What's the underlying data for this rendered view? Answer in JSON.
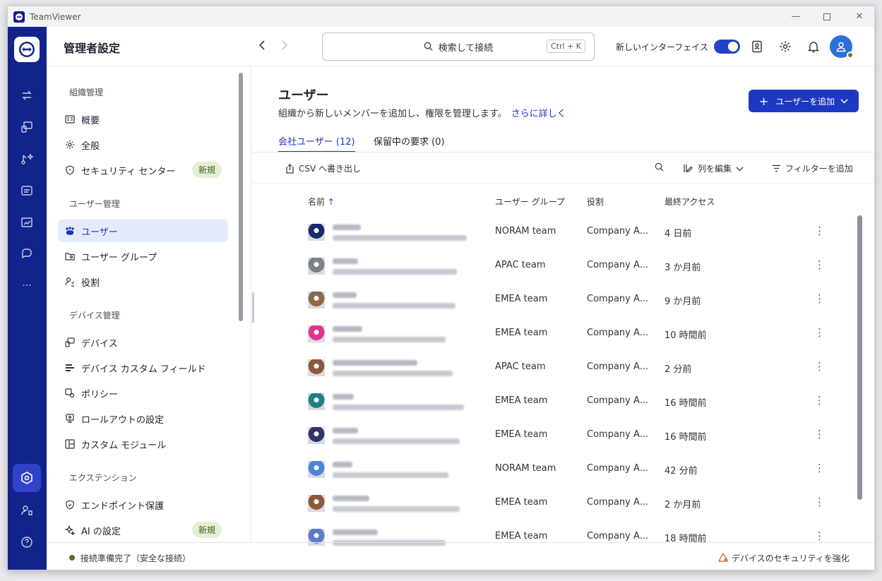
{
  "window": {
    "title": "TeamViewer"
  },
  "header": {
    "page_title": "管理者設定",
    "search_label": "検索して接続",
    "search_shortcut": "Ctrl + K",
    "new_ui_label": "新しいインターフェイス",
    "new_ui_enabled": true
  },
  "sidebar": {
    "sections": [
      {
        "title": "組織管理",
        "items": [
          {
            "label": "概要",
            "icon": "overview-icon"
          },
          {
            "label": "全般",
            "icon": "gear-icon"
          },
          {
            "label": "セキュリティ センター",
            "icon": "shield-icon",
            "badge": "新規"
          }
        ]
      },
      {
        "title": "ユーザー管理",
        "items": [
          {
            "label": "ユーザー",
            "icon": "users-icon",
            "active": true
          },
          {
            "label": "ユーザー グループ",
            "icon": "user-group-icon"
          },
          {
            "label": "役割",
            "icon": "role-icon"
          }
        ]
      },
      {
        "title": "デバイス管理",
        "items": [
          {
            "label": "デバイス",
            "icon": "device-icon"
          },
          {
            "label": "デバイス カスタム フィールド",
            "icon": "custom-field-icon"
          },
          {
            "label": "ポリシー",
            "icon": "policy-icon"
          },
          {
            "label": "ロールアウトの設定",
            "icon": "rollout-icon"
          },
          {
            "label": "カスタム モジュール",
            "icon": "module-icon"
          }
        ]
      },
      {
        "title": "エクステンション",
        "items": [
          {
            "label": "エンドポイント保護",
            "icon": "endpoint-shield-icon"
          },
          {
            "label": "AI の設定",
            "icon": "ai-sparkle-icon",
            "badge": "新規"
          }
        ]
      }
    ]
  },
  "main": {
    "title": "ユーザー",
    "subtitle": "組織から新しいメンバーを追加し、権限を管理します。",
    "learn_more": "さらに詳しく",
    "add_button": "ユーザーを追加",
    "tabs": [
      {
        "label": "会社ユーザー (12)",
        "active": true
      },
      {
        "label": "保留中の要求 (0)",
        "active": false
      }
    ],
    "toolbar": {
      "export": "CSV へ書き出し",
      "edit_columns": "列を編集",
      "add_filter": "フィルターを追加"
    },
    "columns": [
      "名前",
      "ユーザー グループ",
      "役割",
      "最終アクセス"
    ],
    "rows": [
      {
        "group": "NORAM team",
        "role": "Company A...",
        "last": "4 日前",
        "color": "#1b2a6b"
      },
      {
        "group": "APAC team",
        "role": "Company A...",
        "last": "3 か月前",
        "color": "#7d8089"
      },
      {
        "group": "EMEA team",
        "role": "Company A...",
        "last": "9 か月前",
        "color": "#8a6a4a"
      },
      {
        "group": "EMEA team",
        "role": "Company A...",
        "last": "10 時間前",
        "color": "#e0348f"
      },
      {
        "group": "APAC team",
        "role": "Company A...",
        "last": "2 分前",
        "color": "#8b5a3c"
      },
      {
        "group": "EMEA team",
        "role": "Company A...",
        "last": "16 時間前",
        "color": "#1f7f86"
      },
      {
        "group": "EMEA team",
        "role": "Company A...",
        "last": "16 時間前",
        "color": "#2c3566"
      },
      {
        "group": "NORAM team",
        "role": "Company A...",
        "last": "42 分前",
        "color": "#4a86d8"
      },
      {
        "group": "EMEA team",
        "role": "Company A...",
        "last": "2 か月前",
        "color": "#8b5a3c"
      },
      {
        "group": "EMEA team",
        "role": "Company A...",
        "last": "18 時間前",
        "color": "#5a7cc8"
      }
    ]
  },
  "footer": {
    "status": "接続準備完了（安全な接続）",
    "security_link": "デバイスのセキュリティを強化"
  },
  "colors": {
    "brand": "#13238c",
    "accent": "#1f38c4",
    "badge_bg": "#e3f0d6"
  }
}
